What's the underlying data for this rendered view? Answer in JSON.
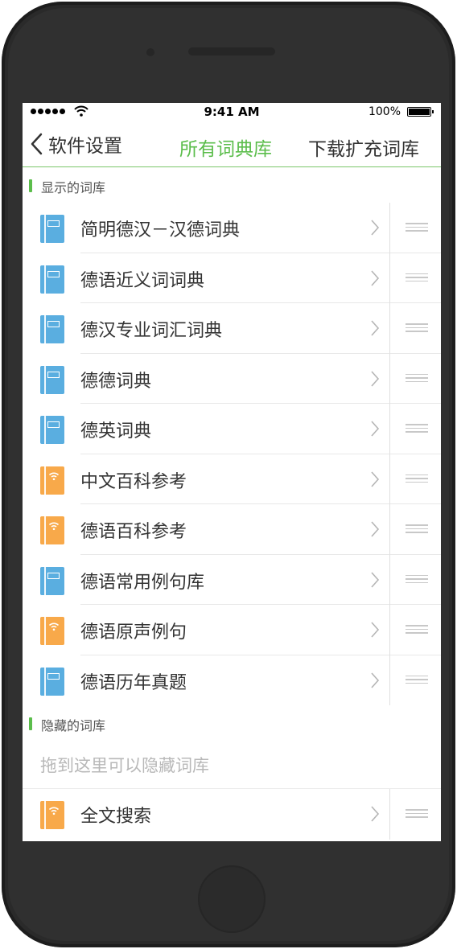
{
  "status_bar": {
    "time": "9:41 AM",
    "battery": "100%"
  },
  "nav": {
    "back_label": "软件设置",
    "title": "所有词典库",
    "right_label": "下载扩充词库"
  },
  "sections": {
    "visible": {
      "title": "显示的词库",
      "items": [
        {
          "label": "简明德汉－汉德词典",
          "icon": "book-icon",
          "color": "#5aaee0"
        },
        {
          "label": "德语近义词词典",
          "icon": "book-icon",
          "color": "#5aaee0"
        },
        {
          "label": "德汉专业词汇词典",
          "icon": "book-icon",
          "color": "#5aaee0"
        },
        {
          "label": "德德词典",
          "icon": "book-icon",
          "color": "#5aaee0"
        },
        {
          "label": "德英词典",
          "icon": "book-icon",
          "color": "#5aaee0"
        },
        {
          "label": "中文百科参考",
          "icon": "online-book-icon",
          "color": "#f8a94a"
        },
        {
          "label": "德语百科参考",
          "icon": "online-book-icon",
          "color": "#f8a94a"
        },
        {
          "label": "德语常用例句库",
          "icon": "book-icon",
          "color": "#5aaee0"
        },
        {
          "label": "德语原声例句",
          "icon": "online-book-icon",
          "color": "#f8a94a"
        },
        {
          "label": "德语历年真题",
          "icon": "book-icon",
          "color": "#5aaee0"
        }
      ]
    },
    "hidden": {
      "title": "隐藏的词库",
      "placeholder": "拖到这里可以隐藏词库",
      "items": [
        {
          "label": "全文搜索",
          "icon": "online-book-icon",
          "color": "#f8a94a"
        }
      ]
    }
  },
  "colors": {
    "accent": "#5bbd4b",
    "blue_icon": "#5aaee0",
    "orange_icon": "#f8a94a"
  }
}
